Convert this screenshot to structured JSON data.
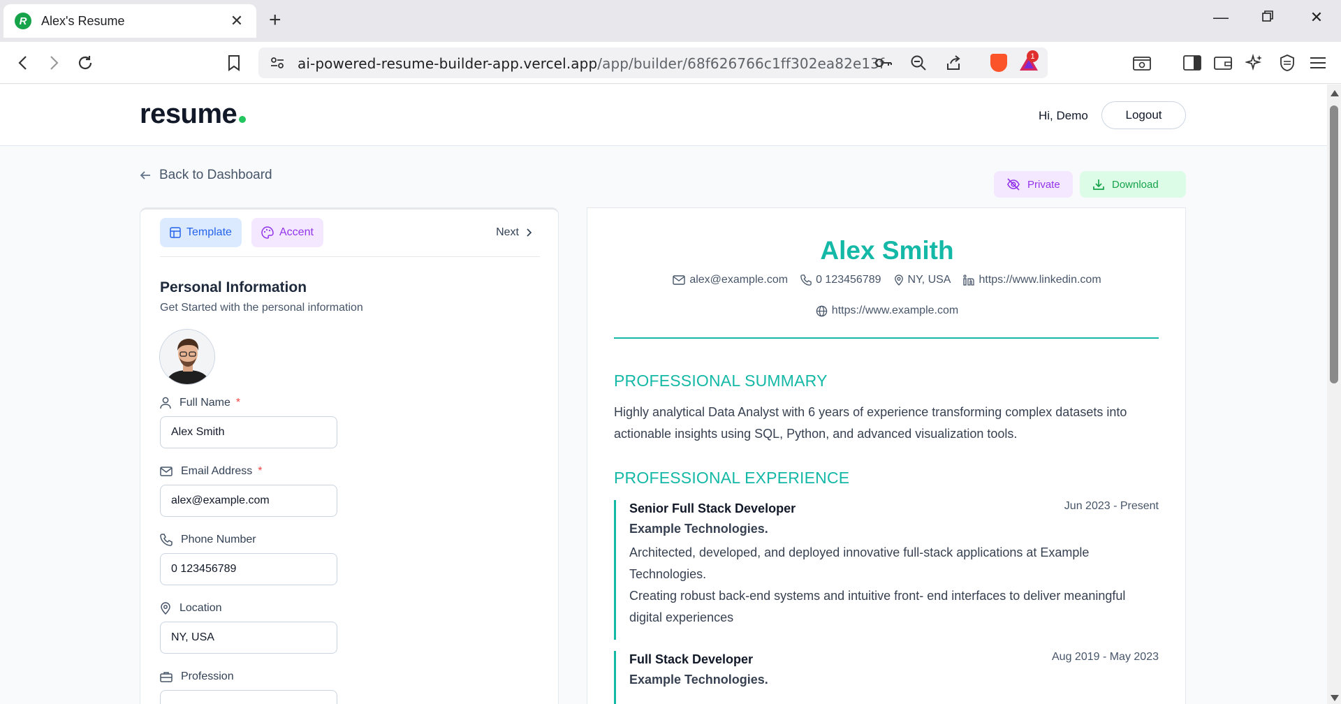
{
  "browser": {
    "tab_title": "Alex's Resume",
    "url_host": "ai-powered-resume-builder-app.vercel.app",
    "url_path": "/app/builder/68f626766c1ff302ea82e13f",
    "rewards_count": "1"
  },
  "header": {
    "logo": "resume",
    "greeting": "Hi, Demo",
    "logout_label": "Logout"
  },
  "toolbar": {
    "back_label": "Back to Dashboard",
    "private_label": "Private",
    "download_label": "Download"
  },
  "editor": {
    "tabs": {
      "template": "Template",
      "accent": "Accent",
      "next": "Next"
    },
    "section_title": "Personal Information",
    "section_subtitle": "Get Started with the personal information",
    "fields": {
      "full_name": {
        "label": "Full Name",
        "required": "*",
        "value": "Alex Smith"
      },
      "email": {
        "label": "Email Address",
        "required": "*",
        "value": "alex@example.com"
      },
      "phone": {
        "label": "Phone Number",
        "value": "0 123456789"
      },
      "location": {
        "label": "Location",
        "value": "NY, USA"
      },
      "profession": {
        "label": "Profession",
        "value": ""
      }
    }
  },
  "resume": {
    "name": "Alex Smith",
    "accent_color": "#14b8a6",
    "contacts": {
      "email": "alex@example.com",
      "phone": "0 123456789",
      "location": "NY, USA",
      "linkedin": "https://www.linkedin.com",
      "website": "https://www.example.com"
    },
    "summary_heading": "PROFESSIONAL SUMMARY",
    "summary": "Highly analytical Data Analyst with 6 years of experience transforming complex datasets into actionable insights using SQL, Python, and advanced visualization tools.",
    "experience_heading": "PROFESSIONAL EXPERIENCE",
    "experience": [
      {
        "title": "Senior Full Stack Developer",
        "company": "Example Technologies.",
        "dates": "Jun 2023 - Present",
        "desc1": "Architected, developed, and deployed innovative full-stack applications at Example Technologies.",
        "desc2": "Creating robust back-end systems and intuitive front- end interfaces to deliver meaningful digital experiences"
      },
      {
        "title": "Full Stack Developer",
        "company": "Example Technologies.",
        "dates": "Aug 2019 - May 2023"
      }
    ]
  }
}
